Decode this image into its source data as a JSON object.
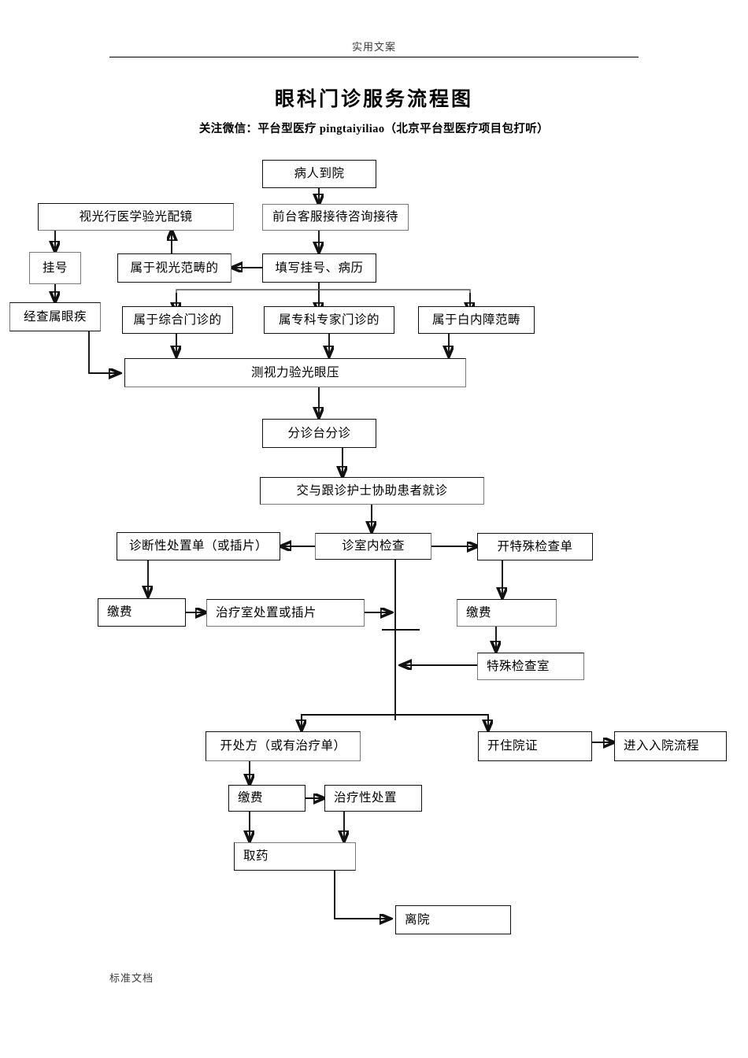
{
  "header": {
    "watermark_top": "实用文案",
    "title": "眼科门诊服务流程图",
    "subtitle": "关注微信：平台型医疗 pingtaiyiliao（北京平台型医疗项目包打听）",
    "watermark_bottom": "标准文档"
  },
  "colors": {
    "box_border": "#7a7a7a",
    "bold_border": "#111111",
    "connector": "#111111",
    "background": "#ffffff",
    "text": "#000000"
  },
  "chart_data": {
    "type": "flowchart",
    "title": "眼科门诊服务流程图",
    "nodes": [
      {
        "id": "patient_arrive",
        "label": "病人到院"
      },
      {
        "id": "optometry_fitting",
        "label": "视光行医学验光配镜"
      },
      {
        "id": "front_desk",
        "label": "前台客服接待咨询接待"
      },
      {
        "id": "register_no",
        "label": "挂号"
      },
      {
        "id": "optometry_scope",
        "label": "属于视光范畴的"
      },
      {
        "id": "fill_registration",
        "label": "填写挂号、病历"
      },
      {
        "id": "eye_disease_found",
        "label": "经查属眼疾"
      },
      {
        "id": "general_clinic",
        "label": "属于综合门诊的"
      },
      {
        "id": "specialist_clinic",
        "label": "属专科专家门诊的"
      },
      {
        "id": "cataract_scope",
        "label": "属于白内障范畴"
      },
      {
        "id": "vision_test",
        "label": "测视力验光眼压"
      },
      {
        "id": "triage_desk",
        "label": "分诊台分诊"
      },
      {
        "id": "nurse_assist",
        "label": "交与跟诊护士协助患者就诊"
      },
      {
        "id": "diagnostic_order",
        "label": "诊断性处置单（或插片）"
      },
      {
        "id": "room_exam",
        "label": "诊室内检查"
      },
      {
        "id": "special_exam_order",
        "label": "开特殊检查单"
      },
      {
        "id": "pay_left",
        "label": "缴费"
      },
      {
        "id": "treatment_room",
        "label": "治疗室处置或插片"
      },
      {
        "id": "pay_right",
        "label": "缴费"
      },
      {
        "id": "special_exam_room",
        "label": "特殊检查室"
      },
      {
        "id": "prescription",
        "label": "开处方（或有治疗单）"
      },
      {
        "id": "admission_cert",
        "label": "开住院证"
      },
      {
        "id": "admission_process",
        "label": "进入入院流程"
      },
      {
        "id": "pay_bottom",
        "label": "缴费"
      },
      {
        "id": "therapeutic_action",
        "label": "治疗性处置"
      },
      {
        "id": "collect_medicine",
        "label": "取药"
      },
      {
        "id": "leave_hospital",
        "label": "离院"
      }
    ],
    "edges": [
      {
        "from": "patient_arrive",
        "to": "front_desk"
      },
      {
        "from": "front_desk",
        "to": "fill_registration"
      },
      {
        "from": "fill_registration",
        "to": "optometry_scope"
      },
      {
        "from": "optometry_scope",
        "to": "optometry_fitting"
      },
      {
        "from": "optometry_fitting",
        "to": "register_no"
      },
      {
        "from": "register_no",
        "to": "eye_disease_found"
      },
      {
        "from": "eye_disease_found",
        "to": "vision_test"
      },
      {
        "from": "fill_registration",
        "to": "general_clinic"
      },
      {
        "from": "fill_registration",
        "to": "specialist_clinic"
      },
      {
        "from": "fill_registration",
        "to": "cataract_scope"
      },
      {
        "from": "general_clinic",
        "to": "vision_test"
      },
      {
        "from": "specialist_clinic",
        "to": "vision_test"
      },
      {
        "from": "cataract_scope",
        "to": "vision_test"
      },
      {
        "from": "vision_test",
        "to": "triage_desk"
      },
      {
        "from": "triage_desk",
        "to": "nurse_assist"
      },
      {
        "from": "nurse_assist",
        "to": "room_exam"
      },
      {
        "from": "room_exam",
        "to": "diagnostic_order"
      },
      {
        "from": "room_exam",
        "to": "special_exam_order"
      },
      {
        "from": "diagnostic_order",
        "to": "pay_left"
      },
      {
        "from": "pay_left",
        "to": "treatment_room"
      },
      {
        "from": "treatment_room",
        "to": "room_exam_spine"
      },
      {
        "from": "special_exam_order",
        "to": "pay_right"
      },
      {
        "from": "pay_right",
        "to": "special_exam_room"
      },
      {
        "from": "special_exam_room",
        "to": "room_exam_spine"
      },
      {
        "from": "room_exam_spine",
        "to": "prescription"
      },
      {
        "from": "room_exam_spine",
        "to": "admission_cert"
      },
      {
        "from": "admission_cert",
        "to": "admission_process"
      },
      {
        "from": "prescription",
        "to": "pay_bottom"
      },
      {
        "from": "pay_bottom",
        "to": "therapeutic_action"
      },
      {
        "from": "pay_bottom",
        "to": "collect_medicine"
      },
      {
        "from": "therapeutic_action",
        "to": "collect_medicine"
      },
      {
        "from": "collect_medicine",
        "to": "leave_hospital"
      }
    ]
  }
}
